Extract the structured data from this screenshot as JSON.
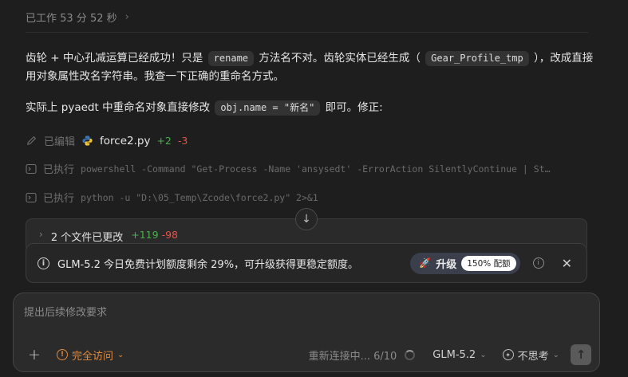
{
  "worked": {
    "label": "已工作 53 分 52 秒"
  },
  "paragraph1": {
    "part1": "齿轮 + 中心孔减运算已经成功！只是 ",
    "code1": "rename",
    "part2": " 方法名不对。齿轮实体已经生成（ ",
    "code2": "Gear_Profile_tmp",
    "part3": " ），改成直接用对象属性改名字符串。我查一下正确的重命名方式。"
  },
  "paragraph2": {
    "part1": "实际上 pyaedt 中重命名对象直接修改 ",
    "code1": "obj.name = \"新名\"",
    "part2": " 即可。修正:"
  },
  "steps": [
    {
      "label": "已编辑",
      "file": "force2.py",
      "added": "+2",
      "removed": "-3"
    },
    {
      "label": "已执行",
      "command": "powershell -Command \"Get-Process -Name 'ansysedt' -ErrorAction SilentlyContinue | St…"
    },
    {
      "label": "已执行",
      "command": "python -u \"D:\\05_Temp\\Zcode\\force2.py\" 2>&1"
    }
  ],
  "files_changed": {
    "label": "2 个文件已更改",
    "added": "+119",
    "removed": "-98"
  },
  "notice": {
    "message": "GLM-5.2 今日免费计划额度剩余 29%，可升级获得更稳定额度。",
    "upgrade_label": "升级",
    "quota_badge": "150% 配额"
  },
  "composer": {
    "placeholder": "提出后续修改要求",
    "access_label": "完全访问",
    "reconnect_status": "重新连接中... 6/10",
    "model": "GLM-5.2",
    "thinking": "不思考"
  },
  "colors": {
    "background": "#1e1e1e",
    "added": "#4caf50",
    "removed": "#e5534b",
    "access_warning": "#e08a3c"
  }
}
